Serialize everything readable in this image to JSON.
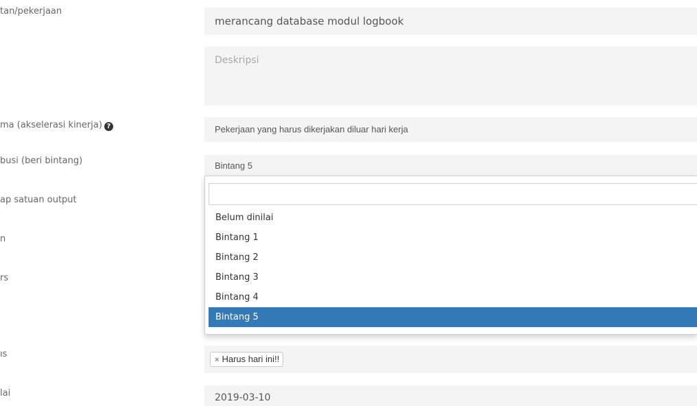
{
  "labels": {
    "kegiatan": "tan/pekerjaan",
    "ekstra": "ma (akselerasi kinerja)",
    "kontribusi": "busi (beri bintang)",
    "satuan": "ap satuan output",
    "row5": "n",
    "row6": "rs",
    "row7": "ıs",
    "tanggal": "lai"
  },
  "fields": {
    "kegiatan_value": "merancang database modul logbook",
    "deskripsi_placeholder": "Deskripsi",
    "ekstra_value": "Pekerjaan yang harus dikerjakan diluar hari kerja",
    "kontribusi_value": "Bintang 5",
    "tag_label": "Harus hari ini!!",
    "tanggal_value": "2019-03-10"
  },
  "dropdown": {
    "search_value": "",
    "options": [
      {
        "label": "Belum dinilai",
        "selected": false
      },
      {
        "label": "Bintang 1",
        "selected": false
      },
      {
        "label": "Bintang 2",
        "selected": false
      },
      {
        "label": "Bintang 3",
        "selected": false
      },
      {
        "label": "Bintang 4",
        "selected": false
      },
      {
        "label": "Bintang 5",
        "selected": true
      }
    ]
  },
  "icons": {
    "help": "question-circle-icon",
    "tag_remove": "×"
  },
  "colors": {
    "field_bg": "#f4f4f4",
    "selected_option_bg": "#337ab7",
    "selected_option_text": "#ffffff"
  }
}
